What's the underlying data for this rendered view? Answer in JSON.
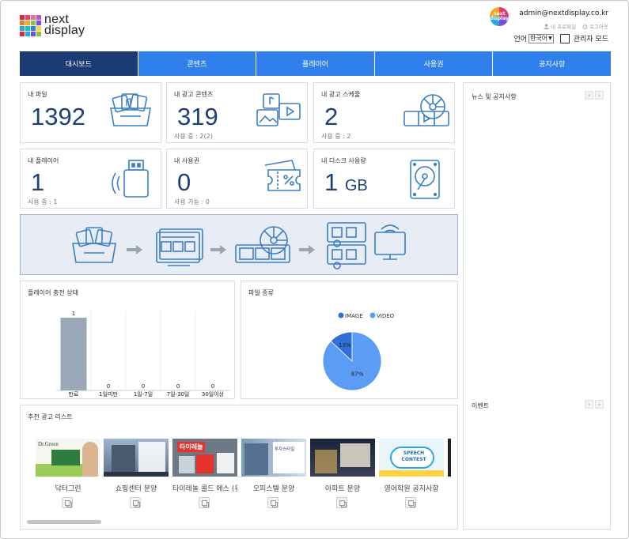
{
  "brand": {
    "line1": "next",
    "line2": "display"
  },
  "account": {
    "email": "admin@nextdisplay.co.kr",
    "avatar_text_1": "next",
    "avatar_text_2": "display",
    "profile_label": "내 프로파일",
    "logout_label": "로그아웃",
    "language_label": "언어",
    "language_value": "한국어",
    "admin_mode_label": "관리자 모드"
  },
  "nav": {
    "tabs": [
      {
        "label": "대시보드",
        "active": true
      },
      {
        "label": "콘텐츠"
      },
      {
        "label": "플레이어"
      },
      {
        "label": "사용권"
      },
      {
        "label": "공지사항"
      }
    ]
  },
  "stats": {
    "files": {
      "title": "내 파일",
      "value": "1392"
    },
    "contents": {
      "title": "내 광고 콘텐츠",
      "value": "319",
      "sub": "사용 중 : 2(2)"
    },
    "schedules": {
      "title": "내 광고 스케줄",
      "value": "2",
      "sub": "사용 중 : 2"
    },
    "players": {
      "title": "내 플레이어",
      "value": "1",
      "sub": "사용 중 : 1"
    },
    "licenses": {
      "title": "내 사용권",
      "value": "0",
      "sub": "사용 가능 : 0"
    },
    "disk": {
      "title": "내 디스크 사용량",
      "value": "1",
      "unit": "GB"
    }
  },
  "player_chart": {
    "title": "플레이어 충전 상태",
    "chart_data": {
      "type": "bar",
      "categories": [
        "만료",
        "1일미만",
        "1일-7일",
        "7일-30일",
        "30일이상"
      ],
      "values": [
        1,
        0,
        0,
        0,
        0
      ],
      "color": "#9aa8b8"
    }
  },
  "file_chart": {
    "title": "파일 종류",
    "chart_data": {
      "type": "pie",
      "labels": [
        "IMAGE",
        "VIDEO"
      ],
      "values": [
        13,
        87
      ],
      "colors": [
        "#2f6fd6",
        "#5b9cf5"
      ],
      "legend_position": "top"
    }
  },
  "recommend": {
    "title": "추천 광고 리스트",
    "items": [
      {
        "label": "닥터그린",
        "thumb_text": "Dr.Green"
      },
      {
        "label": "쇼핑센터 분양",
        "thumb_text": ""
      },
      {
        "label": "타이레놀 콜드 에스 (유",
        "thumb_text": "타이레놀"
      },
      {
        "label": "오피스텔 분양",
        "thumb_text": "투자스타일"
      },
      {
        "label": "아파트 분양",
        "thumb_text": ""
      },
      {
        "label": "영어학원 공지사항",
        "thumb_text": "SPEECH CONTEST"
      }
    ]
  },
  "side": {
    "news_title": "뉴스 및 공지사항",
    "event_title": "이벤트"
  },
  "colors": {
    "primary": "#2f80ed",
    "nav_active": "#1c3a73",
    "stat_number": "#1d3f7a",
    "icon": "#3b7fc4"
  }
}
